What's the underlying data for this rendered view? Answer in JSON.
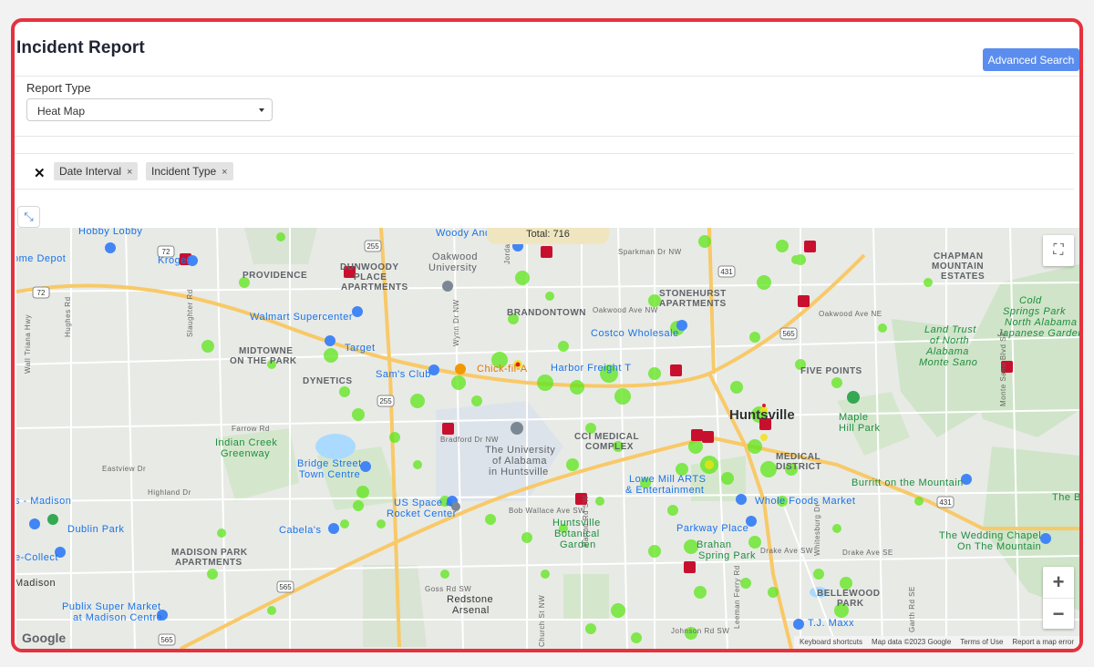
{
  "page": {
    "title": "Incident Report",
    "advanced_search_label": "Advanced Search",
    "report_type_label": "Report Type",
    "report_type_value": "Heat Map",
    "filters": [
      {
        "label": "Date Interval",
        "remove": "×"
      },
      {
        "label": "Incident Type",
        "remove": "×"
      }
    ],
    "clear_filters_icon": "close-icon",
    "expand_icon": "expand-icon"
  },
  "map": {
    "total_label": "Total: 716",
    "google_logo": "Google",
    "footer": [
      "Keyboard shortcuts",
      "Map data ©2023 Google",
      "Terms of Use",
      "Report a map error"
    ],
    "zoom_in": "+",
    "zoom_out": "−",
    "fullscreen_icon": "fullscreen-icon",
    "places": {
      "hobby_lobby": "Hobby Lobby",
      "home_depot": "ome Depot",
      "kroger": "Kroger",
      "providence": "PROVIDENCE",
      "dunnwoody_1": "DUNWOODY",
      "dunnwoody_2": "PLACE",
      "dunnwoody_3": "APARTMENTS",
      "woody_anderson": "Woody And",
      "oakwood_1": "Oakwood",
      "oakwood_2": "University",
      "chapman_1": "CHAPMAN",
      "chapman_2": "MOUNTAIN",
      "chapman_3": "ESTATES",
      "stonehurst_1": "STONEHURST",
      "stonehurst_2": "APARTMENTS",
      "brandontown": "BRANDONTOWN",
      "walmart": "Walmart Supercenter",
      "target": "Target",
      "midtowne_1": "MIDTOWNE",
      "midtowne_2": "ON THE PARK",
      "costco": "Costco Wholesale",
      "cold_springs_1": "Cold",
      "cold_springs_2": "Springs Park",
      "japanese_1": "North Alabama",
      "japanese_2": "Japanese Garden",
      "land_trust_1": "Land Trust",
      "land_trust_2": "of North",
      "land_trust_3": "Alabama",
      "land_trust_4": "Monte Sano",
      "dynetics": "DYNETICS",
      "sams_club": "Sam's Club",
      "chick_fil_a": "Chick-fil-A",
      "harbor_freight": "Harbor Freight T",
      "five_points": "FIVE POINTS",
      "huntsville": "Huntsville",
      "maple_hill_1": "Maple",
      "maple_hill_2": "Hill Park",
      "indian_creek_1": "Indian Creek",
      "indian_creek_2": "Greenway",
      "uah_1": "The University",
      "uah_2": "of Alabama",
      "uah_3": "in Huntsville",
      "cci_1": "CCI MEDICAL",
      "cci_2": "COMPLEX",
      "medical_1": "MEDICAL",
      "medical_2": "DISTRICT",
      "bridge_street_1": "Bridge Street",
      "bridge_street_2": "Town Centre",
      "lowe_mill_1": "Lowe Mill ARTS",
      "lowe_mill_2": "& Entertainment",
      "burritt": "Burritt on the Mountain",
      "whole_foods": "Whole Foods Market",
      "madison": "s - Madison",
      "dublin_park": "Dublin Park",
      "space_1": "US Space &",
      "space_2": "Rocket Center",
      "cabelas": "Cabela's",
      "botanical_1": "Huntsville",
      "botanical_2": "Botanical",
      "botanical_3": "Garden",
      "parkway_place": "Parkway Place",
      "brahan_1": "Brahan",
      "brahan_2": "Spring Park",
      "wedding_1": "The Wedding Chapel",
      "wedding_2": "On The Mountain",
      "the_b": "The B",
      "collect": "e-Collect",
      "madison_city": "Madison",
      "madison_park_1": "MADISON PARK",
      "madison_park_2": "APARTMENTS",
      "publix_1": "Publix Super Market",
      "publix_2": "at Madison Centre",
      "redstone_1": "Redstone",
      "redstone_2": "Arsenal",
      "bellewood_1": "BELLEWOOD",
      "bellewood_2": "PARK",
      "tj_maxx": "T.J. Maxx",
      "drake_ave": "Drake Ave SW",
      "drake_ave_se": "Drake Ave SE",
      "bob_wallace": "Bob Wallace Ave SW",
      "goss_rd": "Goss Rd SW",
      "bradford": "Bradford Dr NW",
      "farrow": "Farrow Rd",
      "eastview": "Eastview Dr",
      "highland": "Highland Dr",
      "oakwood_ave": "Oakwood Ave NW",
      "oakwood_ave_ne": "Oakwood Ave NE",
      "sparkman": "Sparkman Dr NW",
      "johnson_rd": "Johnson Rd SW",
      "hughes": "Hughes Rd",
      "wall_triana": "Wall Triana Hwy",
      "slaughter": "Slaughter Rd",
      "wynn": "Wynn Dr NW",
      "jordan": "Jordan Ln NW",
      "patton": "Patton Rd SW",
      "leeman": "Leeman Ferry Rd",
      "whitesburg": "Whitesburg Dr",
      "garth": "Garth Rd SE",
      "monte_sano": "Monte Sano Blvd SE",
      "church": "Church St NW"
    },
    "route_shields": [
      "72",
      "72",
      "255",
      "255",
      "565",
      "431",
      "431",
      "565",
      "565"
    ]
  }
}
